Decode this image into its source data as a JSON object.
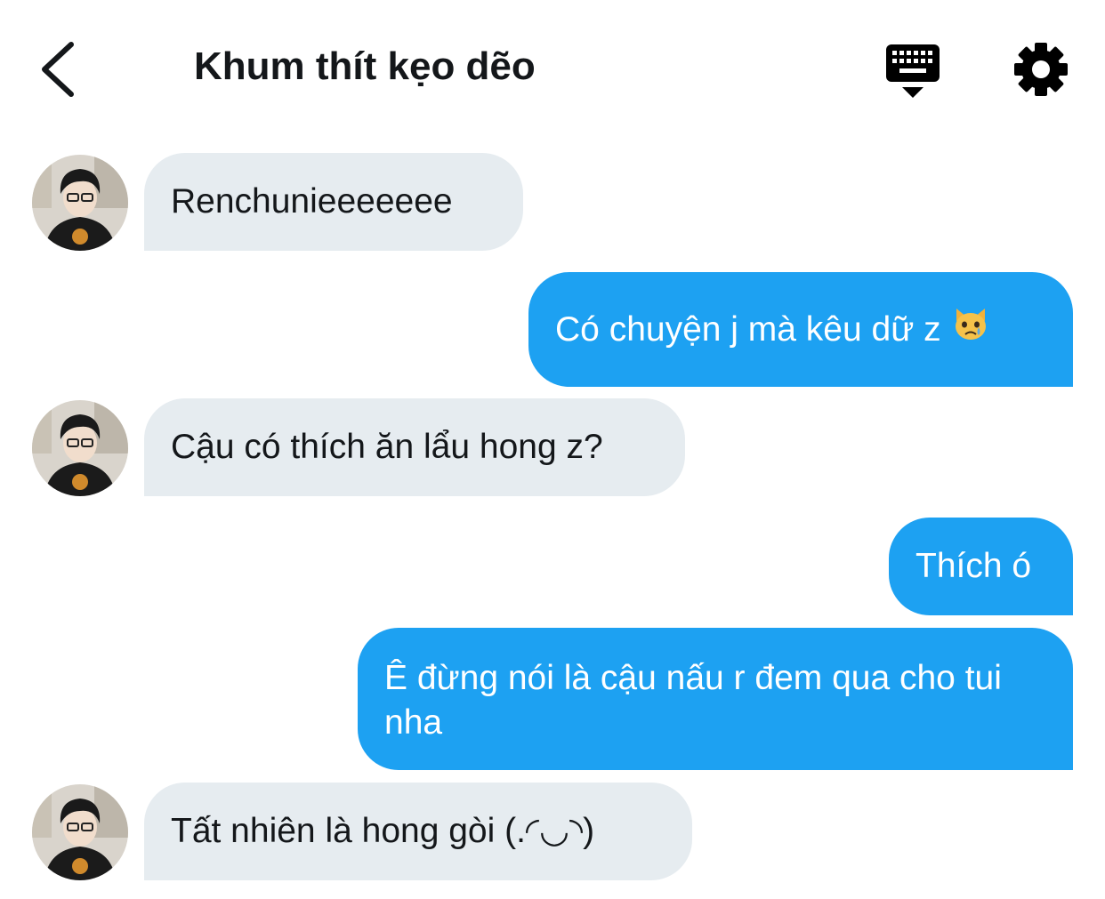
{
  "header": {
    "title": "Khum thít kẹo dẽo",
    "back_icon": "chevron-left-icon",
    "keyboard_icon": "keyboard-hide-icon",
    "settings_icon": "gear-icon"
  },
  "colors": {
    "incoming_bubble": "#e6ecf0",
    "outgoing_bubble": "#1da1f2",
    "incoming_text": "#14171a",
    "outgoing_text": "#ffffff"
  },
  "messages": [
    {
      "direction": "incoming",
      "text": "Renchunieeeeeee"
    },
    {
      "direction": "outgoing",
      "text": "Có chuyện j mà kêu dữ z",
      "emoji": "crying-cat-face-icon"
    },
    {
      "direction": "incoming",
      "text": "Cậu có thích ăn lẩu hong z?"
    },
    {
      "direction": "outgoing",
      "text": "Thích ó"
    },
    {
      "direction": "outgoing",
      "text": "Ê đừng nói là cậu nấu r đem qua cho tui nha"
    },
    {
      "direction": "incoming",
      "text": "Tất nhiên là hong gòi (.◜◡◝)"
    }
  ]
}
